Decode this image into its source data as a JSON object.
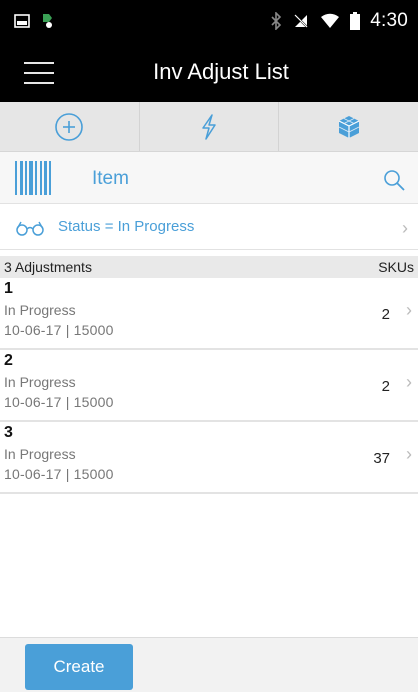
{
  "status_bar": {
    "time": "4:30",
    "icons": [
      "screenshot-icon",
      "app-notification-icon",
      "bluetooth-icon",
      "no-signal-icon",
      "wifi-icon",
      "battery-icon"
    ]
  },
  "app_bar": {
    "title": "Inv Adjust List",
    "menu_icon": "hamburger-menu-icon"
  },
  "toolbar": {
    "tools": [
      "add-circle-icon",
      "lightning-icon",
      "cube-icon"
    ],
    "colors": {
      "icon": "#4a9fd8",
      "background": "#e6e6e6"
    }
  },
  "scan": {
    "label": "Item",
    "barcode_icon": "barcode-icon",
    "search_icon": "search-icon"
  },
  "filter": {
    "text": "Status = In Progress",
    "icon": "glasses-icon"
  },
  "list": {
    "header_left": "3 Adjustments",
    "header_right": "SKUs",
    "items": [
      {
        "id": "1",
        "status": "In Progress",
        "meta": "10-06-17  |  15000",
        "skus": "2"
      },
      {
        "id": "2",
        "status": "In Progress",
        "meta": "10-06-17  |  15000",
        "skus": "2"
      },
      {
        "id": "3",
        "status": "In Progress",
        "meta": "10-06-17  |  15000",
        "skus": "37"
      }
    ]
  },
  "footer": {
    "create_label": "Create"
  },
  "colors": {
    "accent": "#4a9fd8",
    "bar_black": "#000000"
  }
}
